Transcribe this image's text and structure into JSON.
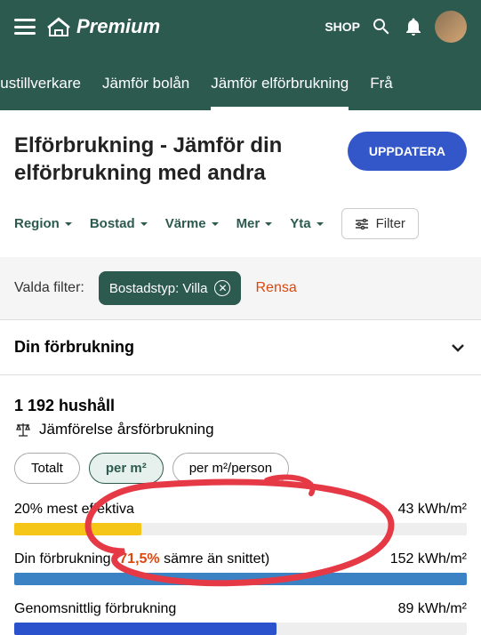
{
  "header": {
    "logo_text": "Premium",
    "shop": "SHOP"
  },
  "tabs": [
    {
      "label": "Hustillverkare"
    },
    {
      "label": "Jämför bolån"
    },
    {
      "label": "Jämför elförbrukning",
      "active": true
    },
    {
      "label": "Frå"
    }
  ],
  "page": {
    "title": "Elförbrukning - Jämför din elförbrukning med andra",
    "update_btn": "UPPDATERA"
  },
  "dropdowns": [
    {
      "label": "Region"
    },
    {
      "label": "Bostad"
    },
    {
      "label": "Värme"
    },
    {
      "label": "Mer"
    },
    {
      "label": "Yta"
    }
  ],
  "filter_btn": "Filter",
  "selected": {
    "label": "Valda filter:",
    "chip": "Bostadstyp: Villa",
    "clear": "Rensa"
  },
  "accordion": {
    "title": "Din förbrukning"
  },
  "stats": {
    "count": "1 192 hushåll",
    "subtitle": "Jämförelse årsförbrukning"
  },
  "pills": [
    {
      "label": "Totalt"
    },
    {
      "label": "per m²",
      "active": true
    },
    {
      "label": "per m²/person"
    }
  ],
  "bars": [
    {
      "label": "20% mest effektiva",
      "value": "43 kWh/m²"
    },
    {
      "label_pre": "Din förbrukning (",
      "highlight": "71,5%",
      "label_post": " sämre än snittet)",
      "value": "152 kWh/m²"
    },
    {
      "label": "Genomsnittlig förbrukning",
      "value": "89 kWh/m²"
    }
  ],
  "colors": {
    "brand": "#2d5a4f",
    "primary_btn": "#3357c9",
    "warn": "#d9480f",
    "yellow": "#f5c518",
    "blue": "#3b82c4"
  }
}
